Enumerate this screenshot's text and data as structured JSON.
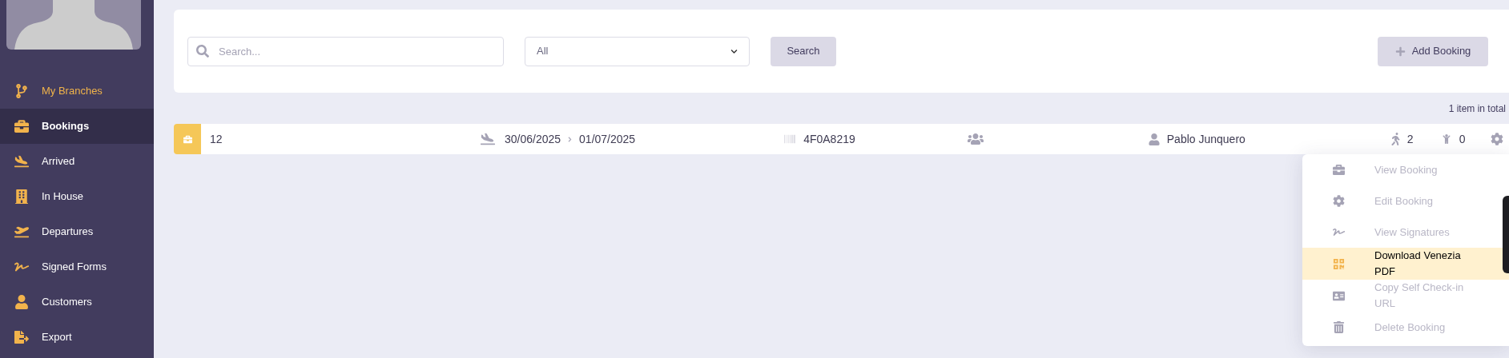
{
  "sidebar": {
    "items": [
      {
        "kind": "branch",
        "label": "My Branches",
        "selected": false,
        "highlighted": true
      },
      {
        "kind": "briefcase",
        "label": "Bookings",
        "selected": true,
        "highlighted": false
      },
      {
        "kind": "arrival",
        "label": "Arrived",
        "selected": false,
        "highlighted": false
      },
      {
        "kind": "building",
        "label": "In House",
        "selected": false,
        "highlighted": false
      },
      {
        "kind": "departure",
        "label": "Departures",
        "selected": false,
        "highlighted": false
      },
      {
        "kind": "signature",
        "label": "Signed Forms",
        "selected": false,
        "highlighted": false
      },
      {
        "kind": "user",
        "label": "Customers",
        "selected": false,
        "highlighted": false
      },
      {
        "kind": "export",
        "label": "Export",
        "selected": false,
        "highlighted": false
      }
    ]
  },
  "toolbar": {
    "search": {
      "placeholder": "Search..."
    },
    "filter": {
      "value": "All"
    },
    "search_button": "Search",
    "add_button": "Add Booking"
  },
  "total": "1 item in total",
  "bookings": [
    {
      "number": "12",
      "check_in": "30/06/2025",
      "check_out": "01/07/2025",
      "code": "4F0A8219",
      "customer": "Pablo Junquero",
      "adults": "2",
      "children": "0"
    }
  ],
  "context_menu": {
    "items": [
      {
        "kind": "briefcase",
        "label": "View Booking",
        "highlighted": false
      },
      {
        "kind": "gear",
        "label": "Edit Booking",
        "highlighted": false
      },
      {
        "kind": "signature",
        "label": "View Signatures",
        "highlighted": false
      },
      {
        "kind": "qrcode",
        "label": "Download Venezia PDF",
        "highlighted": true
      },
      {
        "kind": "contact",
        "label": "Copy Self Check-in URL",
        "highlighted": false
      },
      {
        "kind": "trash",
        "label": "Delete Booking",
        "highlighted": false
      }
    ]
  }
}
